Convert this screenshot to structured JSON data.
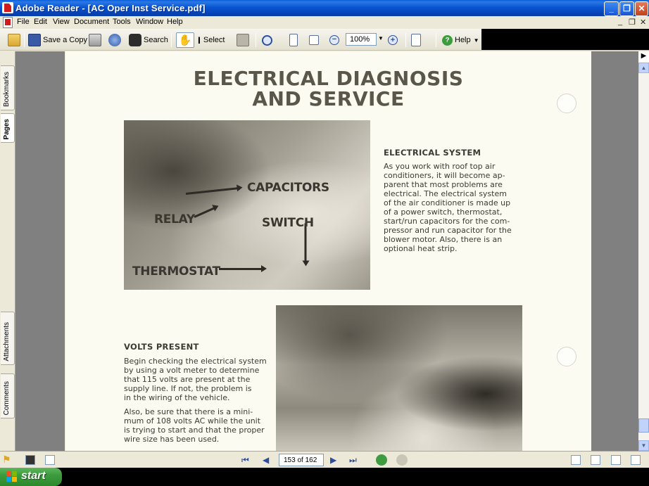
{
  "window": {
    "title": "Adobe Reader - [AC Oper Inst Service.pdf]",
    "minimize_label": "_",
    "restore_label": "❐",
    "close_label": "✕"
  },
  "menu": {
    "items": [
      "File",
      "Edit",
      "View",
      "Document",
      "Tools",
      "Window",
      "Help"
    ],
    "doc_controls": [
      "_",
      "❐",
      "✕"
    ]
  },
  "toolbar": {
    "save_copy_label": "Save a Copy",
    "search_label": "Search",
    "select_label": "Select",
    "zoom_value": "100%",
    "help_label": "Help"
  },
  "nav_tabs": {
    "bookmarks": "Bookmarks",
    "pages": "Pages",
    "attachments": "Attachments",
    "comments": "Comments"
  },
  "document": {
    "title_line1": "ELECTRICAL DIAGNOSIS",
    "title_line2": "AND SERVICE",
    "photo1_labels": {
      "capacitors": "CAPACITORS",
      "relay": "RELAY",
      "switch": "SWITCH",
      "thermostat": "THERMOSTAT"
    },
    "electrical_system": {
      "heading": "ELECTRICAL SYSTEM",
      "lines": [
        "As you work with roof top air",
        "conditioners, it will become ap-",
        "parent that most problems are",
        "electrical. The electrical system",
        "of the air conditioner is made up",
        "of a power switch, thermostat,",
        "start/run capacitors for the com-",
        "pressor and run capacitor for the",
        "blower motor. Also, there is an",
        "optional heat strip."
      ]
    },
    "volts_present": {
      "heading": "VOLTS PRESENT",
      "para1": [
        "Begin checking the electrical system",
        "by using a volt meter to determine",
        "that 115 volts are present at the",
        "supply line. If not, the problem is",
        "in the wiring of the vehicle."
      ],
      "para2": [
        "Also, be sure that there is a mini-",
        "mum of 108 volts AC while the unit",
        "is trying to start and that the proper",
        "wire size has been used."
      ]
    }
  },
  "status": {
    "page_indicator": "153 of 162"
  },
  "taskbar": {
    "start_label": "start"
  },
  "colors": {
    "title_bar": "#0a55d0",
    "page_background": "#fcfbf2",
    "document_text": "#3d3a33",
    "workspace_gray": "#808080"
  }
}
